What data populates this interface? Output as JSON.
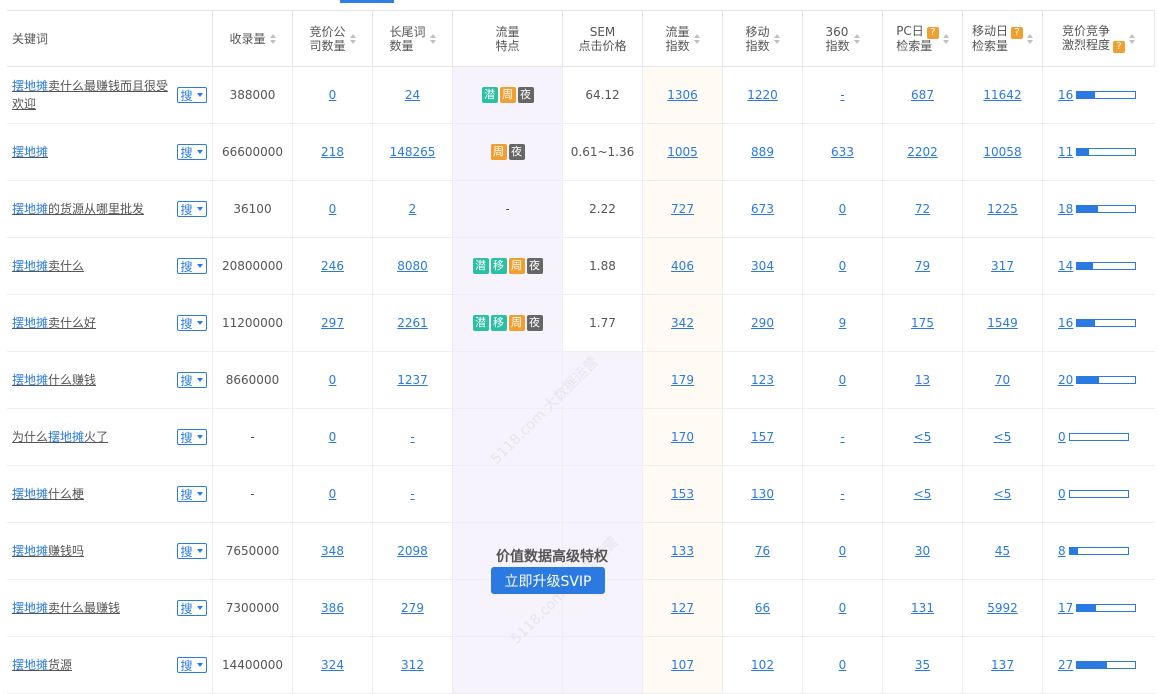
{
  "headers": {
    "keyword": "关键词",
    "indexed": "收录量",
    "bid_companies": [
      "竞价公",
      "司数量"
    ],
    "longtail": [
      "长尾词",
      "数量"
    ],
    "traffic_features": [
      "流量",
      "特点"
    ],
    "sem_price": [
      "SEM",
      "点击价格"
    ],
    "traffic_index": [
      "流量",
      "指数"
    ],
    "mobile_index": [
      "移动",
      "指数"
    ],
    "index_360": [
      "360",
      "指数"
    ],
    "pc_daily": [
      "PC日",
      "检索量"
    ],
    "mobile_daily": [
      "移动日",
      "检索量"
    ],
    "competition": [
      "竞价竞争",
      "激烈程度"
    ],
    "help_icon": "?"
  },
  "search_button_label": "搜",
  "tag_colors": {
    "潜": "#2bbfa4",
    "移": "#2bbfa4",
    "周": "#f0a030",
    "夜": "#666666"
  },
  "rows": [
    {
      "kw_hl": "摆地摊",
      "kw_rest": "卖什么最赚钱而且很受欢迎",
      "indexed": "388000",
      "bid": "0",
      "longtail": "24",
      "tags": [
        "潜",
        "周",
        "夜"
      ],
      "sem": "64.12",
      "traffic": "1306",
      "mobile": "1220",
      "i360": "-",
      "pc": "687",
      "mdaily": "11642",
      "comp": "16",
      "comp_pct": 0.3
    },
    {
      "kw_hl": "摆地摊",
      "kw_rest": "",
      "indexed": "66600000",
      "bid": "218",
      "longtail": "148265",
      "tags": [
        "周",
        "夜"
      ],
      "sem": "0.61~1.36",
      "traffic": "1005",
      "mobile": "889",
      "i360": "633",
      "pc": "2202",
      "mdaily": "10058",
      "comp": "11",
      "comp_pct": 0.2
    },
    {
      "kw_hl": "摆地摊",
      "kw_rest": "的货源从哪里批发",
      "indexed": "36100",
      "bid": "0",
      "longtail": "2",
      "tags": [],
      "tags_text": "-",
      "sem": "2.22",
      "traffic": "727",
      "mobile": "673",
      "i360": "0",
      "pc": "72",
      "mdaily": "1225",
      "comp": "18",
      "comp_pct": 0.35
    },
    {
      "kw_hl": "摆地摊",
      "kw_rest": "卖什么",
      "indexed": "20800000",
      "bid": "246",
      "longtail": "8080",
      "tags": [
        "潜",
        "移",
        "周",
        "夜"
      ],
      "sem": "1.88",
      "traffic": "406",
      "mobile": "304",
      "i360": "0",
      "pc": "79",
      "mdaily": "317",
      "comp": "14",
      "comp_pct": 0.27
    },
    {
      "kw_hl": "摆地摊",
      "kw_rest": "卖什么好",
      "indexed": "11200000",
      "bid": "297",
      "longtail": "2261",
      "tags": [
        "潜",
        "移",
        "周",
        "夜"
      ],
      "sem": "1.77",
      "traffic": "342",
      "mobile": "290",
      "i360": "9",
      "pc": "175",
      "mdaily": "1549",
      "comp": "16",
      "comp_pct": 0.3
    },
    {
      "kw_hl": "摆地摊",
      "kw_rest": "什么赚钱",
      "indexed": "8660000",
      "bid": "0",
      "longtail": "1237",
      "tags": [],
      "sem": "",
      "traffic": "179",
      "mobile": "123",
      "i360": "0",
      "pc": "13",
      "mdaily": "70",
      "comp": "20",
      "comp_pct": 0.38
    },
    {
      "kw_pre": "为什么",
      "kw_hl": "摆地摊",
      "kw_rest": "火了",
      "indexed": "-",
      "bid": "0",
      "longtail": "-",
      "tags": [],
      "sem": "",
      "traffic": "170",
      "mobile": "157",
      "i360": "-",
      "pc": "<5",
      "mdaily": "<5",
      "comp": "0",
      "comp_pct": 0.0
    },
    {
      "kw_hl": "摆地摊",
      "kw_rest": "什么梗",
      "indexed": "-",
      "bid": "0",
      "longtail": "-",
      "tags": [],
      "sem": "",
      "traffic": "153",
      "mobile": "130",
      "i360": "-",
      "pc": "<5",
      "mdaily": "<5",
      "comp": "0",
      "comp_pct": 0.0
    },
    {
      "kw_hl": "摆地摊",
      "kw_rest": "赚钱吗",
      "indexed": "7650000",
      "bid": "348",
      "longtail": "2098",
      "tags": [],
      "sem": "",
      "traffic": "133",
      "mobile": "76",
      "i360": "0",
      "pc": "30",
      "mdaily": "45",
      "comp": "8",
      "comp_pct": 0.15
    },
    {
      "kw_hl": "摆地摊",
      "kw_rest": "卖什么最赚钱",
      "indexed": "7300000",
      "bid": "386",
      "longtail": "279",
      "tags": [],
      "sem": "",
      "traffic": "127",
      "mobile": "66",
      "i360": "0",
      "pc": "131",
      "mdaily": "5992",
      "comp": "17",
      "comp_pct": 0.33
    },
    {
      "kw_hl": "摆地摊",
      "kw_rest": "货源",
      "indexed": "14400000",
      "bid": "324",
      "longtail": "312",
      "tags": [],
      "sem": "",
      "traffic": "107",
      "mobile": "102",
      "i360": "0",
      "pc": "35",
      "mdaily": "137",
      "comp": "27",
      "comp_pct": 0.52
    }
  ],
  "vip": {
    "title": "价值数据高级特权",
    "button": "立即升级SVIP",
    "watermark": "5118.com 大数据运营"
  }
}
